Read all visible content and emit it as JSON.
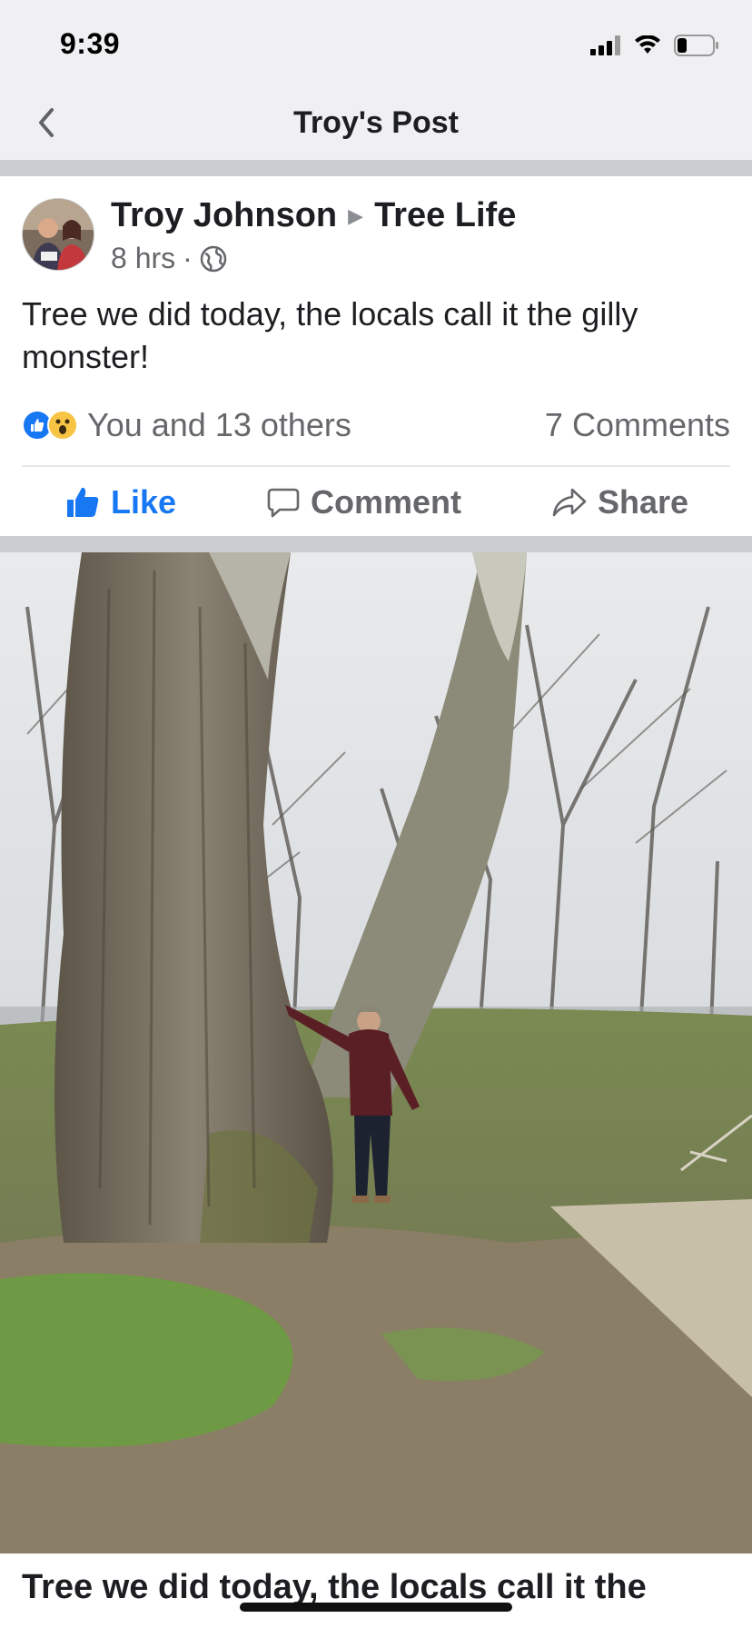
{
  "status_bar": {
    "time": "9:39",
    "icons": [
      "cellular-signal-icon",
      "wifi-icon",
      "battery-icon"
    ]
  },
  "nav": {
    "title": "Troy's Post",
    "back_icon": "chevron-left-icon"
  },
  "post": {
    "author": "Troy Johnson",
    "group": "Tree Life",
    "time": "8 hrs",
    "separator": "·",
    "audience_icon": "globe-icon",
    "text": "Tree we did today, the locals call it the gilly monster!",
    "reactions": {
      "icons": [
        "like-reaction-icon",
        "wow-reaction-icon"
      ],
      "summary": "You and 13 others",
      "comments": "7 Comments"
    },
    "actions": {
      "like": "Like",
      "comment": "Comment",
      "share": "Share"
    },
    "photo_icon": "post-photo",
    "caption": "Tree we did today, the locals call it the"
  },
  "colors": {
    "accent": "#1877f2",
    "bar_bg": "#f0f0f3",
    "divider": "#cacdd1",
    "secondary_text": "#65676b"
  }
}
